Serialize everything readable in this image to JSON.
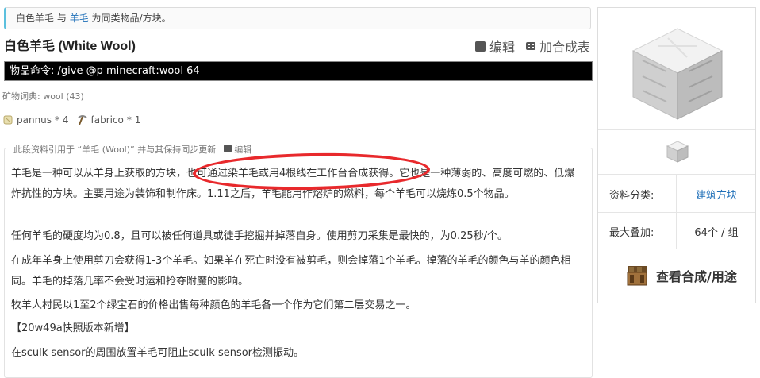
{
  "notice": {
    "item1": "白色羊毛",
    "joiner": "与",
    "item2": "羊毛",
    "suffix": "为同类物品/方块。"
  },
  "page": {
    "title": "白色羊毛 (White Wool)"
  },
  "actions": {
    "edit": "编辑",
    "add_recipe": "加合成表"
  },
  "command": {
    "label": "物品命令:",
    "value": "/give @p minecraft:wool 64"
  },
  "ore_dict": "矿物词典: wool (43)",
  "contributors": [
    {
      "name": "pannus",
      "count": "* 4",
      "icon": "wool-roll-icon"
    },
    {
      "name": "fabrico",
      "count": "* 1",
      "icon": "pickaxe-icon"
    }
  ],
  "section": {
    "caption": "此段资料引用于 “羊毛 (Wool)” 并与其保持同步更新",
    "edit_label": "编辑",
    "paragraphs": [
      "羊毛是一种可以从羊身上获取的方块，也可通过染羊毛或用4根线在工作台合成获得。它也是一种薄弱的、高度可燃的、低爆炸抗性的方块。主要用途为装饰和制作床。1.11之后，羊毛能用作熔炉的燃料，每个羊毛可以烧炼0.5个物品。",
      "任何羊毛的硬度均为0.8，且可以被任何道具或徒手挖掘并掉落自身。使用剪刀采集是最快的，为0.25秒/个。",
      "在成年羊身上使用剪刀会获得1-3个羊毛。如果羊在死亡时没有被剪毛，则会掉落1个羊毛。掉落的羊毛的颜色与羊的颜色相同。羊毛的掉落几率不会受时运和抢夺附魔的影响。",
      "牧羊人村民以1至2个绿宝石的价格出售每种颜色的羊毛各一个作为它们第二层交易之一。",
      "【20w49a快照版本新增】",
      "在sculk sensor的周围放置羊毛可阻止sculk sensor检测振动。"
    ]
  },
  "sidebar": {
    "category_label": "资料分类:",
    "category_value": "建筑方块",
    "stack_label": "最大叠加:",
    "stack_value": "64个 / 组",
    "recipe_button": "查看合成/用途"
  },
  "colors": {
    "link": "#1e6fb8",
    "highlight_circle": "#e8292c",
    "command_bg": "#000000"
  }
}
